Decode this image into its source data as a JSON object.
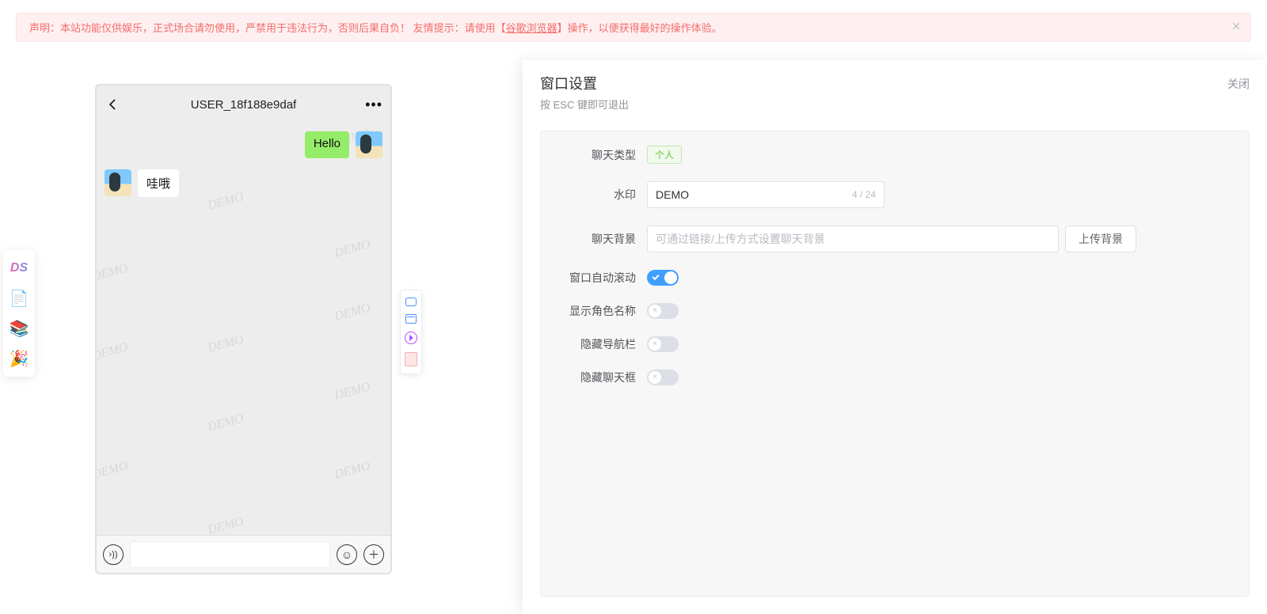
{
  "alert": {
    "text_prefix": "声明：本站功能仅供娱乐，正式场合请勿使用，严禁用于违法行为，否则后果自负！  友情提示：请使用【",
    "link": "谷歌浏览器",
    "text_suffix": "】操作，以便获得最好的操作体验。"
  },
  "left_rail": {
    "items": [
      {
        "name": "logo",
        "glyph": "DS"
      },
      {
        "name": "template",
        "glyph": "📄"
      },
      {
        "name": "book",
        "glyph": "📚"
      },
      {
        "name": "confetti",
        "glyph": "🎉"
      }
    ]
  },
  "phone": {
    "title": "USER_18f188e9daf",
    "watermark": "DEMO",
    "messages": [
      {
        "side": "right",
        "text": "Hello"
      },
      {
        "side": "left",
        "text": "哇哦"
      }
    ]
  },
  "mini_toolbar": {
    "items": [
      {
        "name": "window"
      },
      {
        "name": "date"
      },
      {
        "name": "play"
      },
      {
        "name": "redpacket"
      }
    ]
  },
  "drawer": {
    "title": "窗口设置",
    "subtitle": "按 ESC 键即可退出",
    "close_label": "关闭",
    "rows": {
      "chat_type": {
        "label": "聊天类型",
        "value": "个人"
      },
      "watermark": {
        "label": "水印",
        "value": "DEMO",
        "count": "4 / 24"
      },
      "chat_bg": {
        "label": "聊天背景",
        "placeholder": "可通过链接/上传方式设置聊天背景",
        "upload_btn": "上传背景"
      },
      "auto_scroll": {
        "label": "窗口自动滚动",
        "on": true
      },
      "show_role": {
        "label": "显示角色名称",
        "on": false
      },
      "hide_nav": {
        "label": "隐藏导航栏",
        "on": false
      },
      "hide_chat": {
        "label": "隐藏聊天框",
        "on": false
      }
    }
  }
}
